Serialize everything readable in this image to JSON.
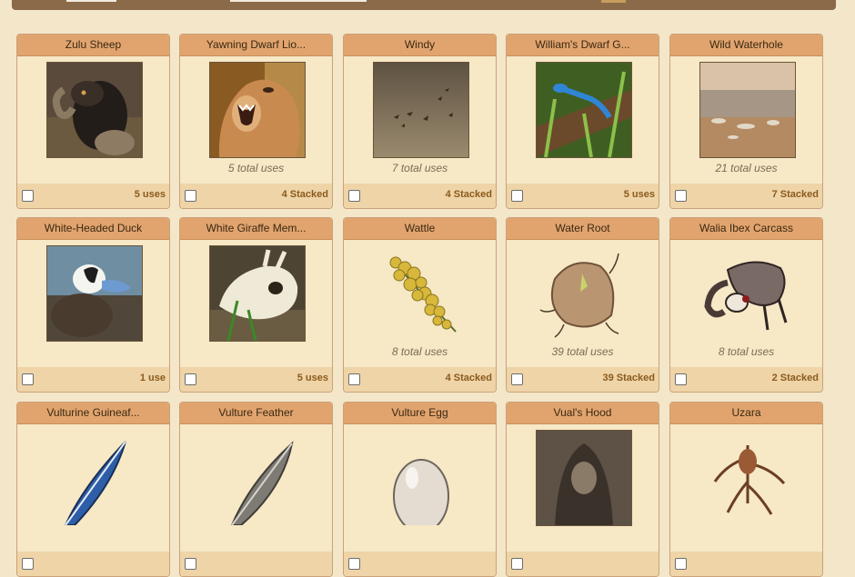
{
  "top_bar": {
    "search_field_1": "",
    "search_field_2": ""
  },
  "items": [
    {
      "name": "Zulu Sheep",
      "uses": "",
      "qty": "5 uses",
      "icon": "sheep-portrait-icon",
      "bg": "#5a4a3b"
    },
    {
      "name": "Yawning Dwarf Lio...",
      "uses": "5 total uses",
      "qty": "4 Stacked",
      "icon": "lion-portrait-icon",
      "bg": "#9b6a2e"
    },
    {
      "name": "Windy",
      "uses": "7 total uses",
      "qty": "4 Stacked",
      "icon": "windy-weather-icon",
      "bg": "#7a6a52"
    },
    {
      "name": "William's Dwarf G...",
      "uses": "",
      "qty": "5 uses",
      "icon": "gecko-portrait-icon",
      "bg": "#4f6b2a"
    },
    {
      "name": "Wild Waterhole",
      "uses": "21 total uses",
      "qty": "7 Stacked",
      "icon": "waterhole-landscape-icon",
      "bg": "#b39a82"
    },
    {
      "name": "White-Headed Duck",
      "uses": "",
      "qty": "1 use",
      "icon": "duck-portrait-icon",
      "bg": "#6f8ea2"
    },
    {
      "name": "White Giraffe Mem...",
      "uses": "",
      "qty": "5 uses",
      "icon": "giraffe-skull-icon",
      "bg": "#4d4434"
    },
    {
      "name": "Wattle",
      "uses": "8 total uses",
      "qty": "4 Stacked",
      "icon": "wattle-flower-icon",
      "bg": ""
    },
    {
      "name": "Water Root",
      "uses": "39 total uses",
      "qty": "39 Stacked",
      "icon": "water-root-icon",
      "bg": ""
    },
    {
      "name": "Walia Ibex Carcass",
      "uses": "8 total uses",
      "qty": "2 Stacked",
      "icon": "ibex-carcass-icon",
      "bg": ""
    },
    {
      "name": "Vulturine Guineaf...",
      "uses": "",
      "qty": "",
      "icon": "guineafowl-feather-icon",
      "bg": ""
    },
    {
      "name": "Vulture Feather",
      "uses": "",
      "qty": "",
      "icon": "vulture-feather-icon",
      "bg": ""
    },
    {
      "name": "Vulture Egg",
      "uses": "",
      "qty": "",
      "icon": "egg-icon",
      "bg": ""
    },
    {
      "name": "Vual's Hood",
      "uses": "",
      "qty": "",
      "icon": "hood-portrait-icon",
      "bg": "#5e5246"
    },
    {
      "name": "Uzara",
      "uses": "",
      "qty": "",
      "icon": "uzara-root-icon",
      "bg": ""
    }
  ]
}
